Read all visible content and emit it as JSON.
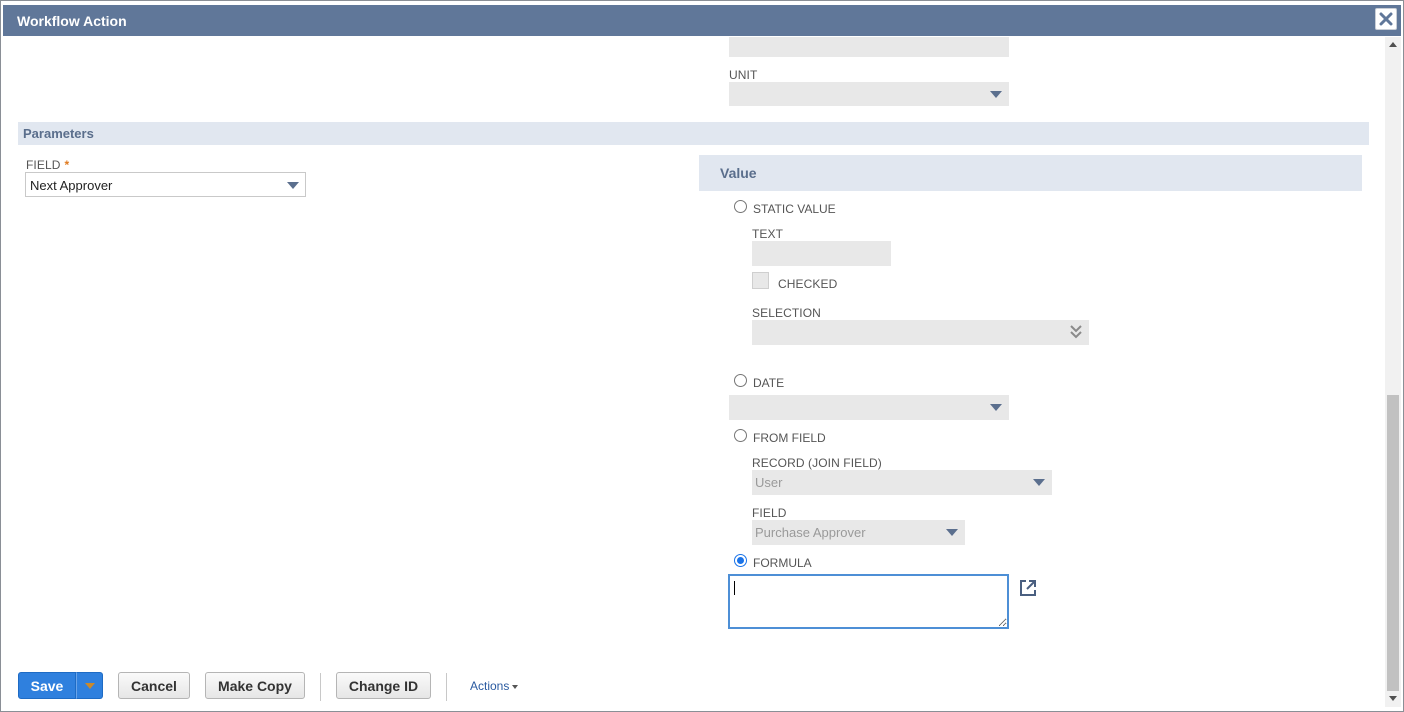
{
  "window": {
    "title": "Workflow Action"
  },
  "top": {
    "unit_label": "UNIT"
  },
  "parameters": {
    "section_title": "Parameters",
    "field_label": "FIELD",
    "required_mark": "*",
    "field_value": "Next Approver"
  },
  "value": {
    "section_title": "Value",
    "static_value_label": "STATIC VALUE",
    "text_label": "TEXT",
    "checked_label": "CHECKED",
    "selection_label": "SELECTION",
    "date_label": "DATE",
    "from_field_label": "FROM FIELD",
    "record_label": "RECORD (JOIN FIELD)",
    "record_value": "User",
    "field_label": "FIELD",
    "field_value": "Purchase Approver",
    "formula_label": "FORMULA",
    "selected_option": "FORMULA"
  },
  "footer": {
    "save_label": "Save",
    "cancel_label": "Cancel",
    "make_copy_label": "Make Copy",
    "change_id_label": "Change ID",
    "actions_label": "Actions"
  },
  "colors": {
    "titlebar": "#607799",
    "section_bg": "#e1e7f0",
    "section_text": "#5a6e8c",
    "primary": "#2f80de",
    "required": "#e07b20"
  },
  "icons": {
    "close": "close-icon",
    "external": "open-external-icon",
    "dropdown": "caret-down-icon",
    "multiselect": "double-chevron-down-icon"
  }
}
